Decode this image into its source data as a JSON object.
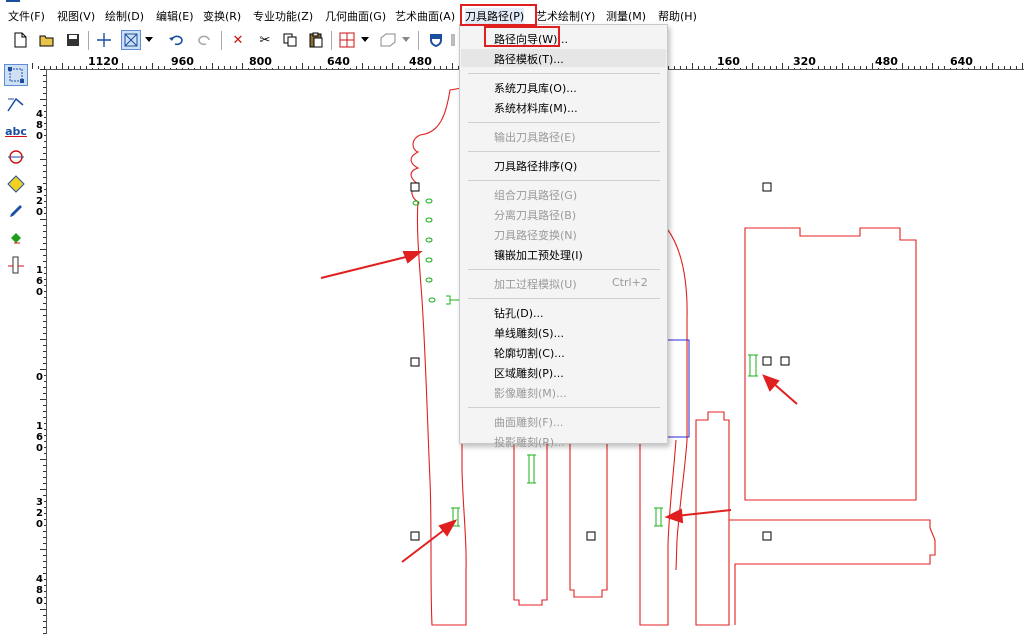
{
  "menubar": {
    "items": [
      "文件(F)",
      "视图(V)",
      "绘制(D)",
      "编辑(E)",
      "变换(R)",
      "专业功能(Z)",
      "几何曲面(G)",
      "艺术曲面(A)",
      "刀具路径(P)",
      "艺术绘制(Y)",
      "测量(M)",
      "帮助(H)"
    ],
    "open_index": 8
  },
  "toolbar": {
    "icons": [
      "new-file-icon",
      "open-folder-icon",
      "save-icon",
      "crosshair-icon",
      "select-box-icon",
      "dropdown-arrow-icon",
      "undo-icon",
      "redo-icon",
      "delete-x-icon",
      "cut-icon",
      "copy-icon",
      "paste-icon",
      "grid-snap-icon",
      "dropdown-arrow-icon",
      "view-3d-icon",
      "dropdown-arrow-icon",
      "shield-icon"
    ]
  },
  "left_tools": {
    "icons": [
      "node-edit-icon",
      "vector-arrow-icon",
      "text-abc-icon",
      "circle-target-icon",
      "diamond-shape-icon",
      "pen-draw-icon",
      "fill-bucket-icon",
      "measure-ruler-icon"
    ],
    "text_tool_label": "abc"
  },
  "ruler": {
    "horizontal_labels": [
      "1120",
      "960",
      "800",
      "640",
      "480",
      "160",
      "320",
      "480",
      "640"
    ],
    "vertical_labels": [
      "480",
      "320",
      "160",
      "0",
      "160",
      "320",
      "480"
    ]
  },
  "dropdown": {
    "title": "刀具路径(P)",
    "items": [
      {
        "label": "路径向导(W)...",
        "enabled": true,
        "highlighted": false,
        "outlined": true
      },
      {
        "label": "路径模板(T)...",
        "enabled": true,
        "highlighted": true
      },
      {
        "separator": true
      },
      {
        "label": "系统刀具库(O)...",
        "enabled": true
      },
      {
        "label": "系统材料库(M)...",
        "enabled": true
      },
      {
        "separator": true
      },
      {
        "label": "输出刀具路径(E)",
        "enabled": false
      },
      {
        "separator": true
      },
      {
        "label": "刀具路径排序(Q)",
        "enabled": true
      },
      {
        "separator": true
      },
      {
        "label": "组合刀具路径(G)",
        "enabled": false
      },
      {
        "label": "分离刀具路径(B)",
        "enabled": false
      },
      {
        "label": "刀具路径变换(N)",
        "enabled": false
      },
      {
        "label": "镶嵌加工预处理(I)",
        "enabled": true
      },
      {
        "separator": true
      },
      {
        "label": "加工过程模拟(U)",
        "enabled": false,
        "shortcut": "Ctrl+2"
      },
      {
        "separator": true
      },
      {
        "label": "钻孔(D)...",
        "enabled": true
      },
      {
        "label": "单线雕刻(S)...",
        "enabled": true
      },
      {
        "label": "轮廓切割(C)...",
        "enabled": true
      },
      {
        "label": "区域雕刻(P)...",
        "enabled": true
      },
      {
        "label": "影像雕刻(M)...",
        "enabled": false
      },
      {
        "separator": true
      },
      {
        "label": "曲面雕刻(F)...",
        "enabled": false
      },
      {
        "label": "投影雕刻(R)...",
        "enabled": false
      }
    ]
  },
  "colors": {
    "outline": "#e02020",
    "toolpath": "#18b018",
    "highlight_box": "#e02020",
    "ruler_text": "#000000",
    "selection_rect": "#2a2ad0"
  }
}
